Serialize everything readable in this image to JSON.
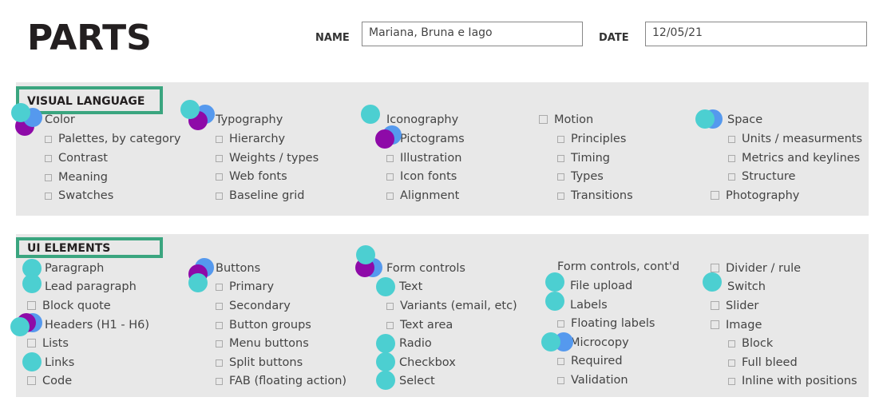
{
  "title": "PARTS",
  "form": {
    "name_label": "NAME",
    "name_value": "Mariana, Bruna e Iago",
    "date_label": "DATE",
    "date_value": "12/05/21"
  },
  "colors": {
    "section_bg": "#e8e8e8",
    "header_frame": "#3aa57f",
    "dot_teal": "#4ccfd1",
    "dot_blue": "#5599ee",
    "dot_purple": "#8e0aa8"
  },
  "visual_language": {
    "heading": "VISUAL LANGUAGE",
    "columns": [
      {
        "title": "Color",
        "items": [
          "Palettes, by category",
          "Contrast",
          "Meaning",
          "Swatches"
        ]
      },
      {
        "title": "Typography",
        "items": [
          "Hierarchy",
          "Weights / types",
          "Web fonts",
          "Baseline grid"
        ]
      },
      {
        "title": "Iconography",
        "items": [
          "Pictograms",
          "Illustration",
          "Icon fonts",
          "Alignment"
        ]
      },
      {
        "title": "Motion",
        "items": [
          "Principles",
          "Timing",
          "Types",
          "Transitions"
        ]
      },
      {
        "title": "Space",
        "items": [
          "Units / measurments",
          "Metrics and keylines",
          "Structure"
        ],
        "extra": "Photography"
      }
    ]
  },
  "ui_elements": {
    "heading": "UI ELEMENTS",
    "col1": [
      "Paragraph",
      "Lead paragraph",
      "Block quote",
      "Headers (H1 - H6)",
      "Lists",
      "Links",
      "Code"
    ],
    "col2": {
      "title": "Buttons",
      "items": [
        "Primary",
        "Secondary",
        "Button groups",
        "Menu buttons",
        "Split buttons",
        "FAB (floating action)"
      ]
    },
    "col3": {
      "title": "Form controls",
      "items": [
        "Text",
        "Variants (email, etc)",
        "Text area",
        "Radio",
        "Checkbox",
        "Select"
      ]
    },
    "col4": {
      "title": "Form controls, cont'd",
      "items": [
        "File upload",
        "Labels",
        "Floating labels",
        "Microcopy",
        "Required",
        "Validation"
      ]
    },
    "col5": {
      "items": [
        "Divider / rule",
        "Switch",
        "Slider",
        "Image"
      ],
      "sub": [
        "Block",
        "Full bleed",
        "Inline with positions"
      ]
    }
  }
}
